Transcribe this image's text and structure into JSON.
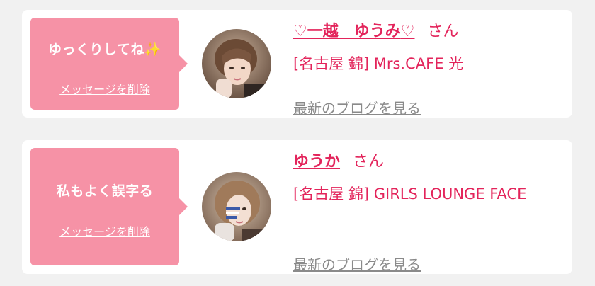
{
  "messages": [
    {
      "bubble_text": "ゆっくりしてね",
      "bubble_emoji": "✨",
      "delete_label": "メッセージを削除",
      "cast_name_prefix": "♡",
      "cast_name": "一越　ゆうみ",
      "cast_name_suffix": "♡",
      "honorific": "さん",
      "shop": "[名古屋 錦] Mrs.CAFE 光",
      "blog_label": "最新のブログを見る"
    },
    {
      "bubble_text": "私もよく誤字る",
      "delete_label": "メッセージを削除",
      "cast_name": "ゆうか",
      "honorific": "さん",
      "shop": "[名古屋 錦] GIRLS LOUNGE FACE",
      "blog_label": "最新のブログを見る"
    }
  ],
  "colors": {
    "page_bg": "#f1f1f1",
    "card_bg": "#ffffff",
    "bubble_bg": "#f692a6",
    "accent_pink": "#e3245b",
    "link_gray": "#8a8a8a"
  }
}
